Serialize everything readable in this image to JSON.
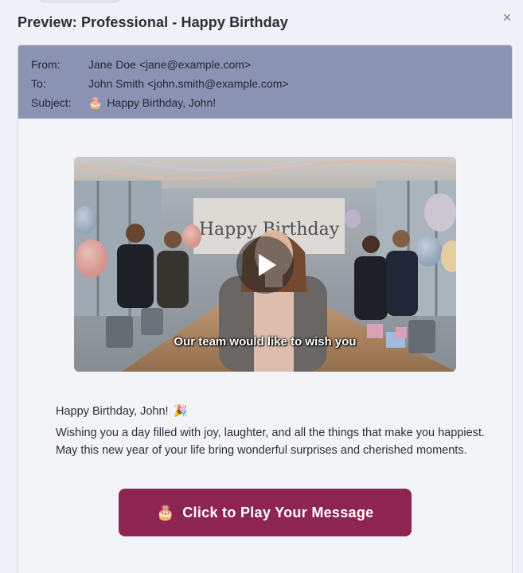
{
  "modal": {
    "title": "Preview: Professional - Happy Birthday",
    "close_glyph": "×"
  },
  "email": {
    "header": {
      "from_label": "From:",
      "from_value": "Jane Doe <jane@example.com>",
      "to_label": "To:",
      "to_value": "John Smith <john.smith@example.com>",
      "subject_label": "Subject:",
      "subject_icon": "🎂",
      "subject_value": "Happy Birthday, John!"
    },
    "video": {
      "caption": "Our team would like to wish you",
      "banner_text": "Happy Birthday",
      "play_icon": "play-icon"
    },
    "greeting": "Happy Birthday, John!",
    "greeting_icon": "🎉",
    "body": "Wishing you a day filled with joy, laughter, and all the things that make you happiest. May this new year of your life bring wonderful surprises and cherished moments.",
    "cta": {
      "icon": "🎂",
      "label": "Click to Play Your Message"
    }
  },
  "colors": {
    "header_bg": "#8b93b3",
    "cta_bg": "#8e2550",
    "page_bg": "#eef1f6"
  }
}
